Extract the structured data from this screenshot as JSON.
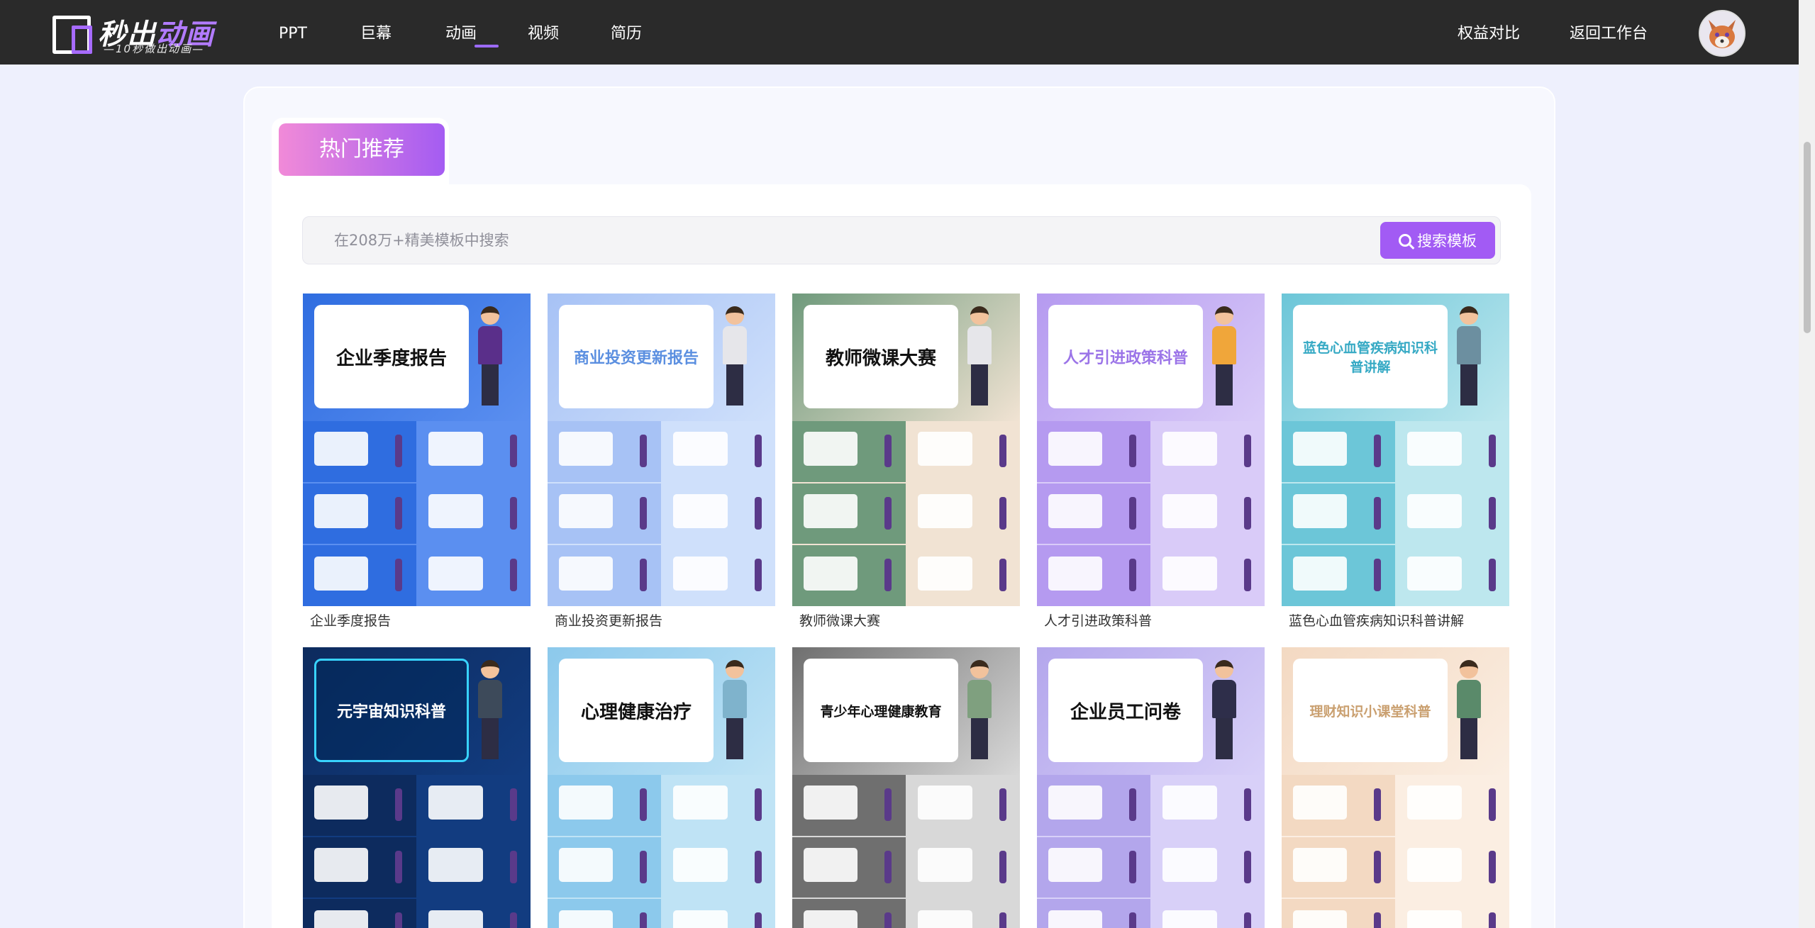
{
  "header": {
    "logo_title": "秒出",
    "logo_title_accent": "动画",
    "logo_subtitle": "—10秒做出动画—",
    "nav": [
      {
        "label": "PPT",
        "active": false
      },
      {
        "label": "巨幕",
        "active": false
      },
      {
        "label": "动画",
        "active": true
      },
      {
        "label": "视频",
        "active": false
      },
      {
        "label": "简历",
        "active": false
      }
    ],
    "right_links": [
      "权益对比",
      "返回工作台"
    ],
    "avatar_icon": "fox-avatar"
  },
  "section_tab": "热门推荐",
  "search": {
    "placeholder": "在208万+精美模板中搜索",
    "value": "",
    "button_label": "搜索模板",
    "button_icon": "search-icon"
  },
  "colors": {
    "accent": "#a25bf4",
    "tab_gradient_start": "#f18ad8",
    "tab_gradient_end": "#a45cf2",
    "topbar": "#2a2a2a"
  },
  "templates": [
    {
      "label": "企业季度报告",
      "cover_title": "企业季度报告",
      "bg": "#2f6de0",
      "bg2": "#5b8ff0",
      "title_color": "#111111",
      "shirt": "#5a2f8a"
    },
    {
      "label": "商业投资更新报告",
      "cover_title": "商业投资更新报告",
      "bg": "#a7c2f5",
      "bg2": "#cfe0fb",
      "title_color": "#5b8fe0",
      "shirt": "#e6e6ea"
    },
    {
      "label": "教师微课大赛",
      "cover_title": "教师微课大赛",
      "bg": "#6f9a7c",
      "bg2": "#f1e3d3",
      "title_color": "#111111",
      "shirt": "#e6e6ea"
    },
    {
      "label": "人才引进政策科普",
      "cover_title": "人才引进政策科普",
      "bg": "#b59af0",
      "bg2": "#d9cbf8",
      "title_color": "#9b74e8",
      "shirt": "#f0a63a"
    },
    {
      "label": "蓝色心血管疾病知识科普讲解",
      "cover_title": "蓝色心血管疾病知识科普讲解",
      "bg": "#6cc6d8",
      "bg2": "#bde7ee",
      "title_color": "#35a9c4",
      "shirt": "#6c8fa0"
    },
    {
      "label": "",
      "cover_title": "元宇宙知识科普",
      "bg": "#0d2b5e",
      "bg2": "#123c80",
      "title_color": "#ffffff",
      "shirt": "#3d4a5a"
    },
    {
      "label": "",
      "cover_title": "心理健康治疗",
      "bg": "#8cc9ec",
      "bg2": "#bfe3f5",
      "title_color": "#111111",
      "shirt": "#7fb3cc"
    },
    {
      "label": "",
      "cover_title": "青少年心理健康教育",
      "bg": "#6f6f6f",
      "bg2": "#d8d8d8",
      "title_color": "#111111",
      "shirt": "#7fa07f"
    },
    {
      "label": "",
      "cover_title": "企业员工问卷",
      "bg": "#b3a6ec",
      "bg2": "#d8d0f8",
      "title_color": "#111111",
      "shirt": "#2e2e4a"
    },
    {
      "label": "",
      "cover_title": "理财知识小课堂科普",
      "bg": "#f3d9c2",
      "bg2": "#fbeee2",
      "title_color": "#caa070",
      "shirt": "#5a8a6a"
    }
  ]
}
